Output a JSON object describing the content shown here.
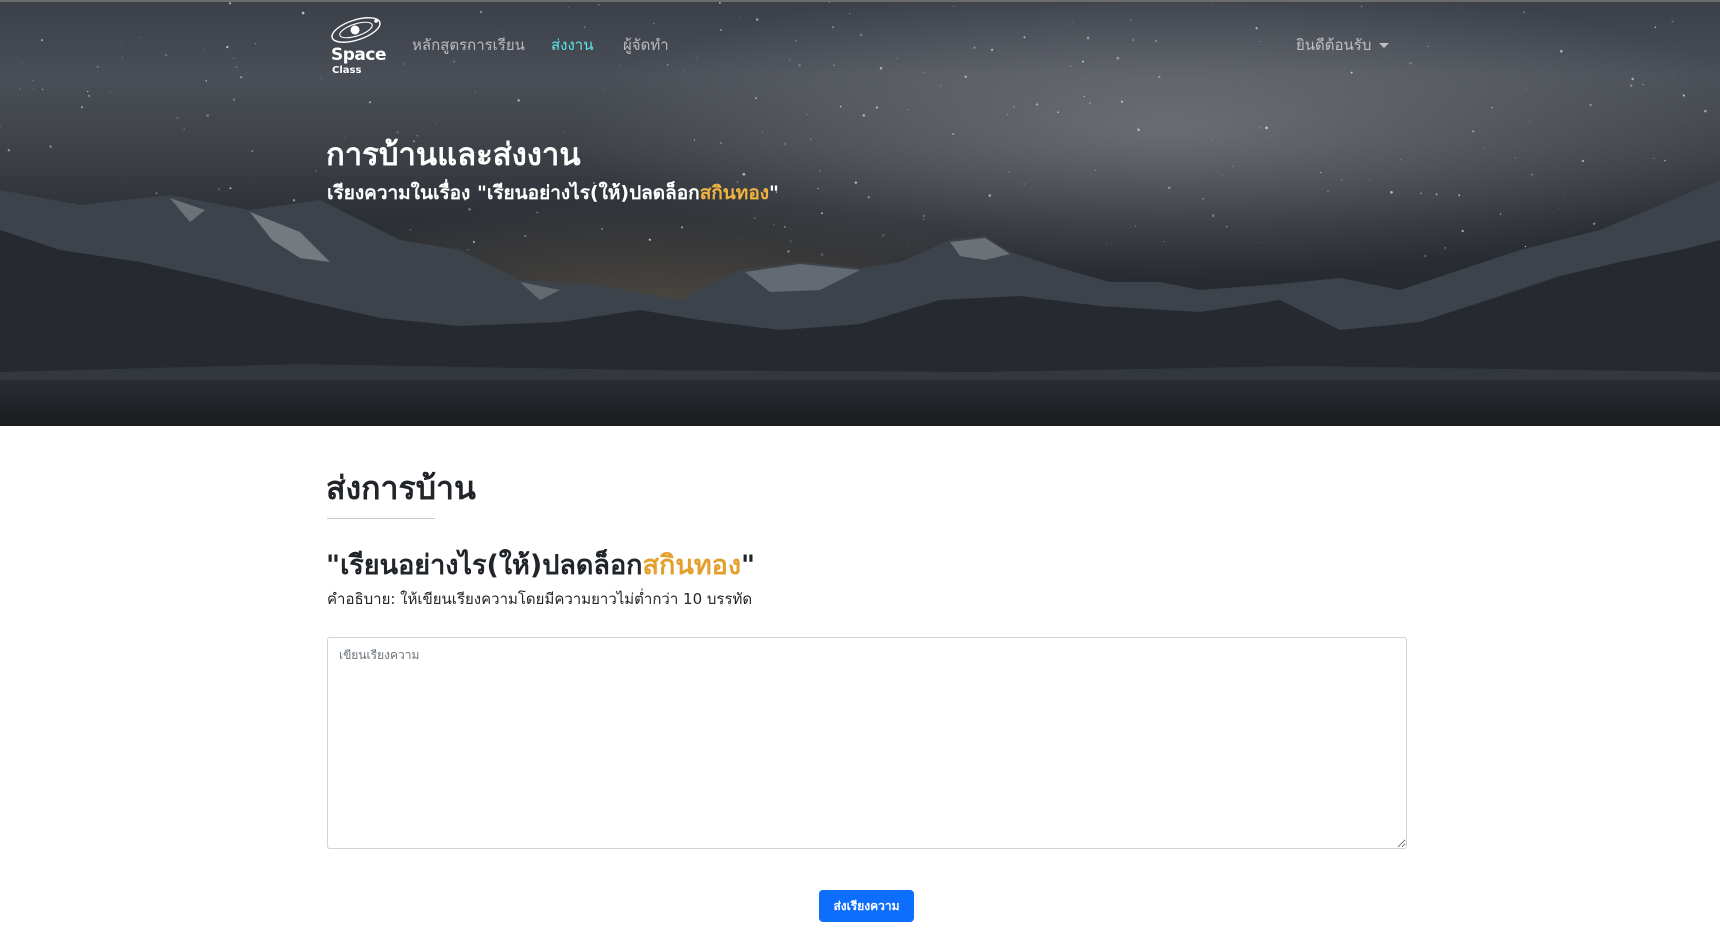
{
  "colors": {
    "accent_gold": "#f0b23e",
    "nav_active": "#5ee6e8",
    "button_primary": "#0d6efd"
  },
  "brand": {
    "line1": "Space",
    "line2": "Class",
    "icon": "planet-orbit-logo"
  },
  "nav": {
    "items": [
      {
        "label": "หลักสูตรการเรียน",
        "active": false
      },
      {
        "label": "ส่งงาน",
        "active": true
      },
      {
        "label": "ผู้จัดทำ",
        "active": false
      }
    ],
    "welcome_label": "ยินดีต้อนรับ",
    "welcome_icon": "caret-down-icon"
  },
  "hero": {
    "title": "การบ้านและส่งงาน",
    "subtitle_prefix": "เรียงความในเรื่อง \"เรียนอย่างไร(ให้)ปลดล็อก",
    "subtitle_accent": "สกินทอง",
    "subtitle_suffix": "\""
  },
  "main": {
    "section_title": "ส่งการบ้าน",
    "topic_prefix": "\"เรียนอย่างไร(ให้)ปลดล็อก",
    "topic_accent": "สกินทอง",
    "topic_suffix": "\"",
    "instruction": "คำอธิบาย: ให้เขียนเรียงความโดยมีความยาวไม่ต่ำกว่า 10 บรรทัด",
    "essay_placeholder": "เขียนเรียงความ",
    "essay_value": "",
    "submit_label": "ส่งเรียงความ"
  }
}
